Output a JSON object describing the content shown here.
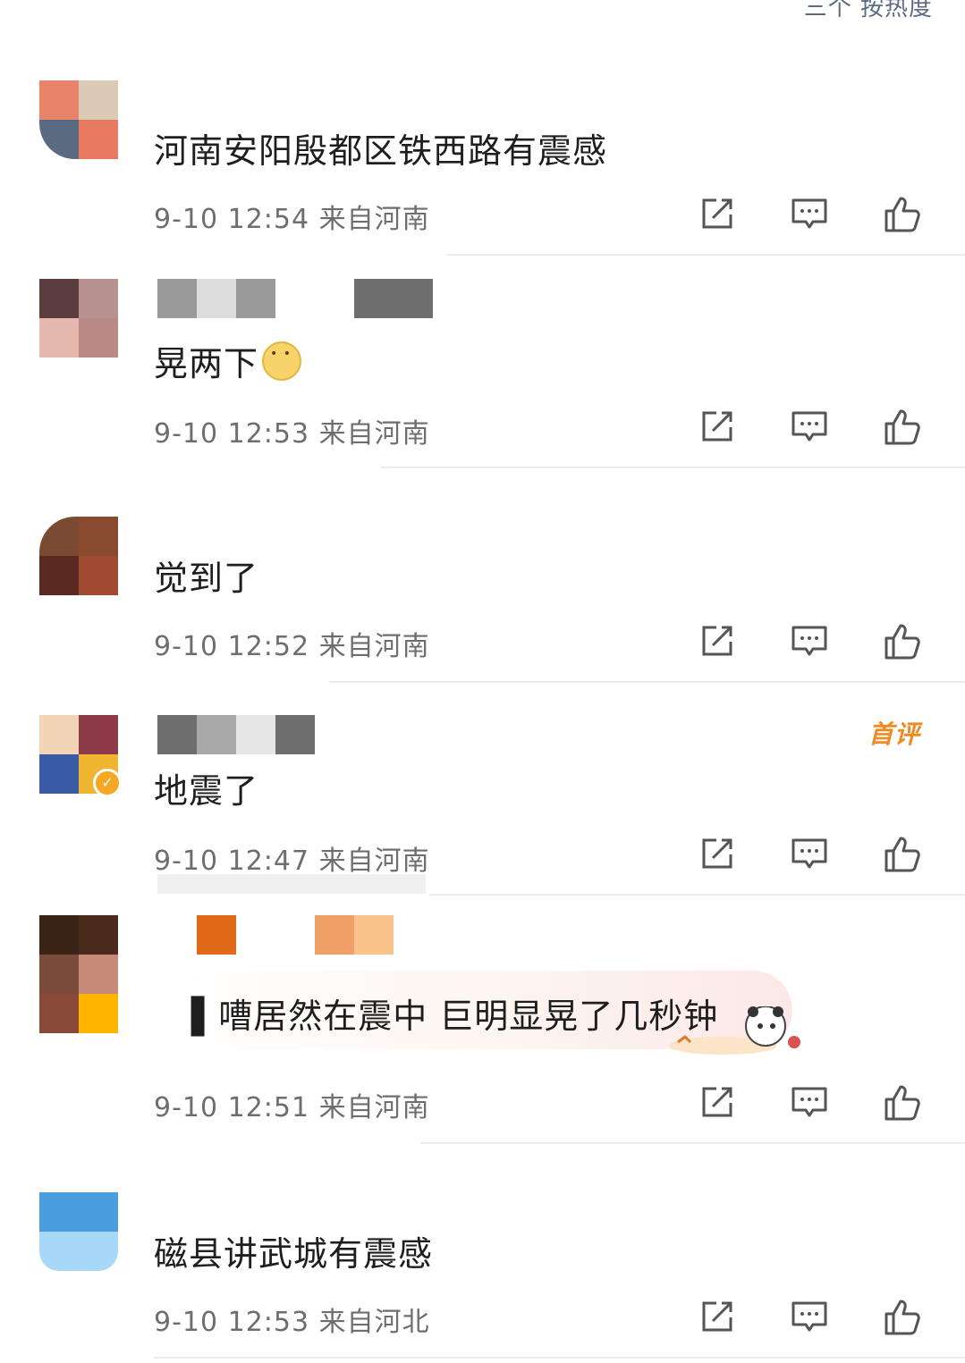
{
  "sort_label": "三个 按热度",
  "colors": {
    "text": "#1e1e1e",
    "meta": "#6e6e6e",
    "icon": "#555555",
    "first_badge": "#f08a24",
    "divider": "#ececec"
  },
  "comments": [
    {
      "text": "河南安阳殷都区铁西路有震感",
      "time": "9-10 12:54",
      "location": "来自河南",
      "avatar_colors": [
        "#e8846a",
        "#dbcab6",
        "#5a6a80",
        "#e87a60"
      ],
      "username_blocks": []
    },
    {
      "text": "晃两下",
      "time": "9-10 12:53",
      "location": "来自河南",
      "avatar_colors": [
        "#5a3b3e",
        "#b79090",
        "#e6b9b0",
        "#b98a85"
      ],
      "username_blocks": [
        "#9a9a9a",
        "#dcdcdc",
        "#9a9a9a",
        "#ffffff",
        "#ffffff",
        "#6e6e6e",
        "#6e6e6e"
      ],
      "emoji": "doge-emoji"
    },
    {
      "text": "觉到了",
      "time": "9-10 12:52",
      "location": "来自河南",
      "avatar_colors": [
        "#7a4a32",
        "#8a4a30",
        "#5a2a22",
        "#a04a32"
      ],
      "username_blocks": []
    },
    {
      "text": "地震了",
      "time": "9-10 12:47",
      "location": "来自河南",
      "avatar_colors": [
        "#f2d4b6",
        "#8c3a48",
        "#3a5aa6",
        "#f0b430"
      ],
      "username_blocks": [
        "#6e6e6e",
        "#a8a8a8",
        "#e6e6e6",
        "#6e6e6e"
      ],
      "badge": "首评"
    },
    {
      "text": "▌嘈居然在震中 巨明显晃了几秒钟",
      "time": "9-10 12:51",
      "location": "来自河南",
      "avatar_colors": [
        "#3a2418",
        "#4a2a1c",
        "#7a4a3a",
        "#c88a78"
      ],
      "username_blocks": [
        "#ffffff",
        "#e06a18",
        "#ffffff",
        "#ffffff",
        "#f0a066",
        "#f8c48c"
      ]
    },
    {
      "text": "磁县讲武城有震感",
      "time": "9-10 12:53",
      "location": "来自河北",
      "avatar_colors": [
        "#4a9ee0",
        "#4a9ee0",
        "#a8d8f8",
        "#a8d8f8"
      ],
      "username_blocks": []
    }
  ]
}
